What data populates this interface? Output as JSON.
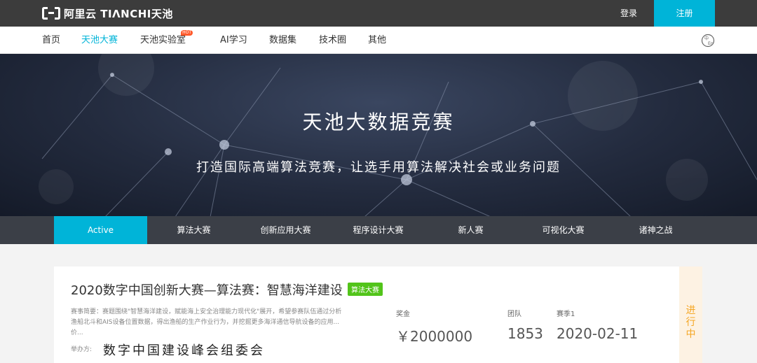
{
  "header": {
    "logo_text": "阿里云 TIΛNCHI天池",
    "login_label": "登录",
    "register_label": "注册",
    "accent_color": "#00b4d8"
  },
  "nav": {
    "items": [
      {
        "label": "首页"
      },
      {
        "label": "天池大赛"
      },
      {
        "label": "天池实验室",
        "badge": "HOT"
      },
      {
        "label": "AI学习"
      },
      {
        "label": "数据集"
      },
      {
        "label": "技术圈"
      },
      {
        "label": "其他"
      }
    ],
    "active": "天池大赛",
    "lang_icon": "language-switch-icon"
  },
  "hero": {
    "title": "天池大数据竞赛",
    "subtitle": "打造国际高端算法竞赛，让选手用算法解决社会或业务问题"
  },
  "tabs": [
    {
      "label": "Active"
    },
    {
      "label": "算法大赛"
    },
    {
      "label": "创新应用大赛"
    },
    {
      "label": "程序设计大赛"
    },
    {
      "label": "新人赛"
    },
    {
      "label": "可视化大赛"
    },
    {
      "label": "诸神之战"
    }
  ],
  "competition": {
    "title": "2020数字中国创新大赛—算法赛：智慧海洋建设",
    "tag": "算法大赛",
    "desc_line1": "赛事简要：赛题围绕\"智慧海洋建设，赋能海上安全治理能力现代化\"展开，希望参赛队伍通过分析",
    "desc_line2": "渔船北斗和AIS设备位置数据，得出渔船的生产作业行为，并挖掘更多海洋通信导航设备的应用...",
    "desc_line3": "价...",
    "organizer_label": "举办方:",
    "organizer": "数字中国建设峰会组委会",
    "prize_label": "奖金",
    "prize_value": "￥2000000",
    "teams_label": "团队",
    "teams_value": "1853",
    "season_label": "赛季1",
    "season_value": "2020-02-11",
    "status": [
      "进",
      "行",
      "中"
    ]
  }
}
